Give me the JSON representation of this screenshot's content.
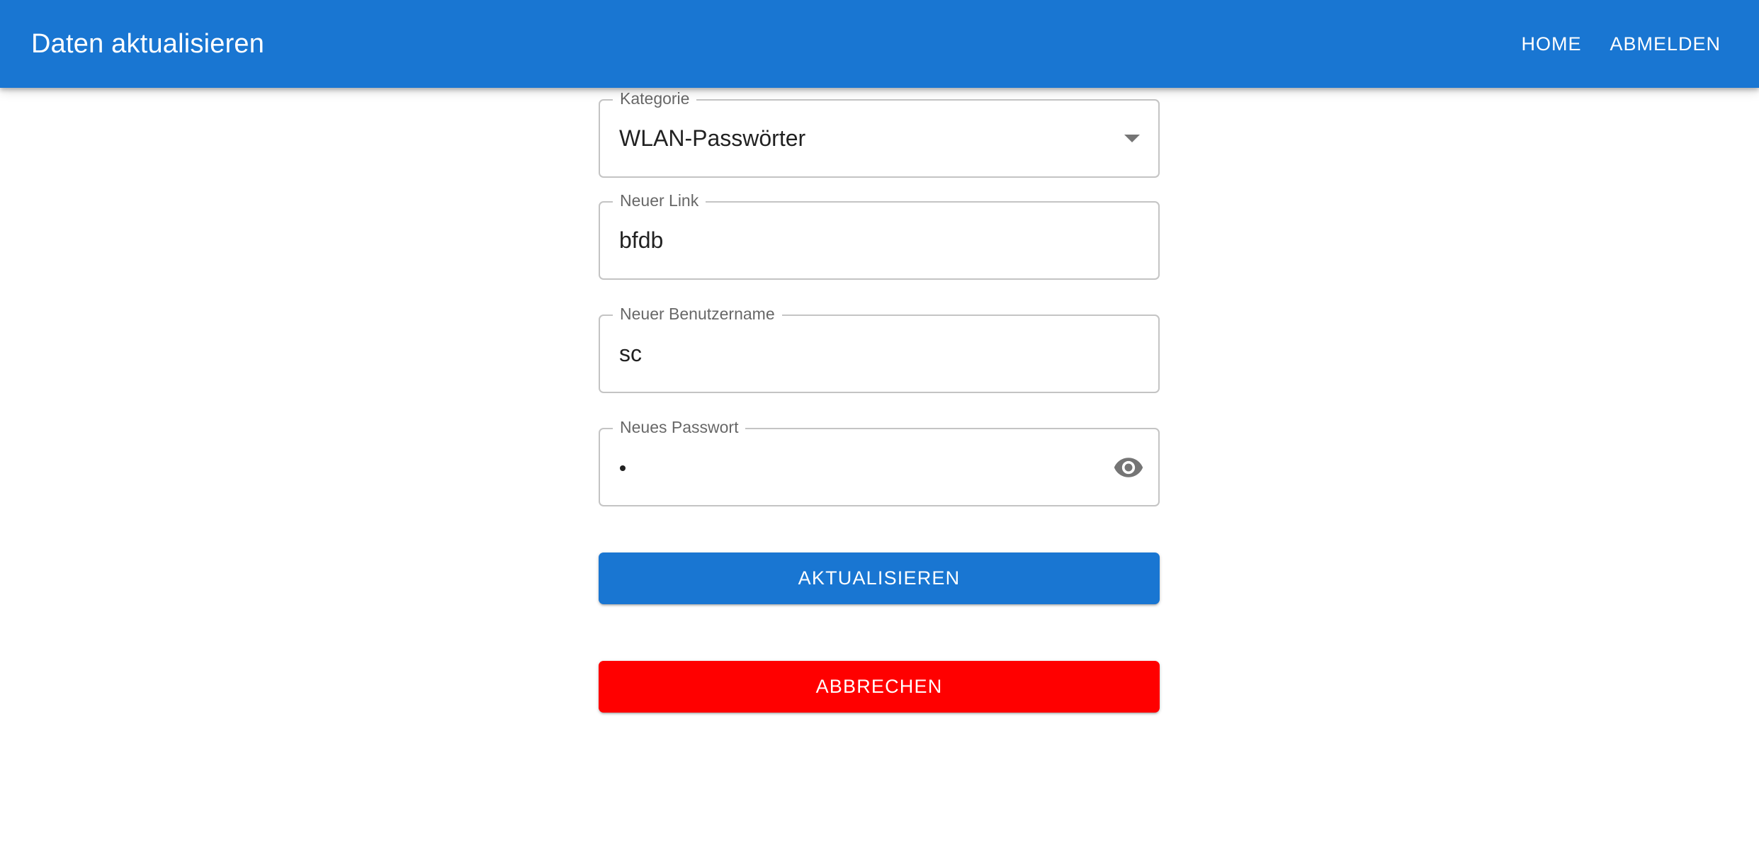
{
  "appbar": {
    "title": "Daten aktualisieren",
    "home_label": "HOME",
    "logout_label": "ABMELDEN",
    "color": "#1976d2"
  },
  "form": {
    "category": {
      "label": "Kategorie",
      "value": "WLAN-Passwörter",
      "icon": "chevron-down-icon"
    },
    "link": {
      "label": "Neuer Link",
      "value": "bfdb"
    },
    "username": {
      "label": "Neuer Benutzername",
      "value": "sc"
    },
    "password": {
      "label": "Neues Passwort",
      "masked_value": "•",
      "icon": "eye-icon"
    },
    "update_button": {
      "label": "AKTUALISIEREN",
      "color": "#1976d2"
    },
    "cancel_button": {
      "label": "ABBRECHEN",
      "color": "#ff0000"
    }
  }
}
